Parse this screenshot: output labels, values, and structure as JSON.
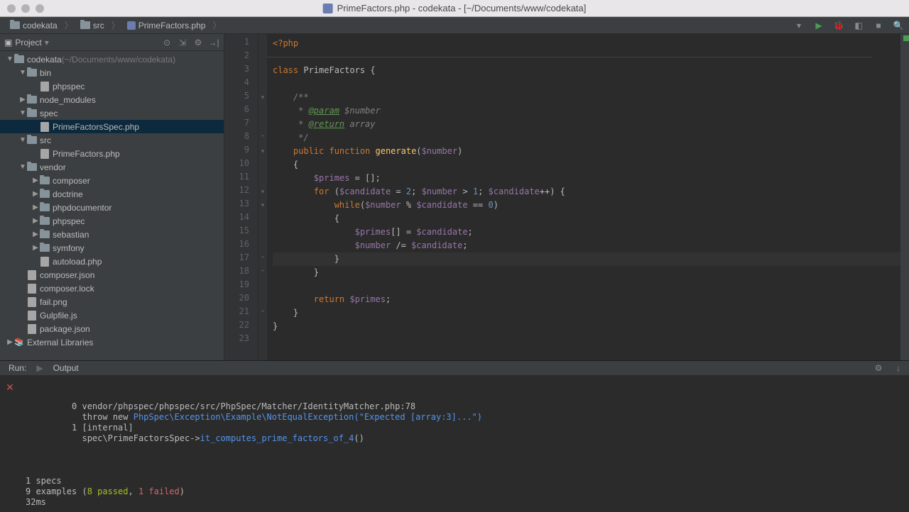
{
  "window": {
    "title": "PrimeFactors.php - codekata - [~/Documents/www/codekata]"
  },
  "breadcrumbs": [
    {
      "label": "codekata",
      "type": "folder"
    },
    {
      "label": "src",
      "type": "folder"
    },
    {
      "label": "PrimeFactors.php",
      "type": "file"
    }
  ],
  "sidebar": {
    "title": "Project",
    "items": [
      {
        "label": "codekata",
        "hint": "(~/Documents/www/codekata)",
        "type": "folder",
        "indent": 0,
        "chevron": "down"
      },
      {
        "label": "bin",
        "type": "folder",
        "indent": 1,
        "chevron": "down"
      },
      {
        "label": "phpspec",
        "type": "file",
        "indent": 2,
        "chevron": ""
      },
      {
        "label": "node_modules",
        "type": "folder",
        "indent": 1,
        "chevron": "right"
      },
      {
        "label": "spec",
        "type": "folder",
        "indent": 1,
        "chevron": "down"
      },
      {
        "label": "PrimeFactorsSpec.php",
        "type": "file",
        "indent": 2,
        "chevron": "",
        "selected": true
      },
      {
        "label": "src",
        "type": "folder",
        "indent": 1,
        "chevron": "down"
      },
      {
        "label": "PrimeFactors.php",
        "type": "file",
        "indent": 2,
        "chevron": ""
      },
      {
        "label": "vendor",
        "type": "folder",
        "indent": 1,
        "chevron": "down"
      },
      {
        "label": "composer",
        "type": "folder",
        "indent": 2,
        "chevron": "right"
      },
      {
        "label": "doctrine",
        "type": "folder",
        "indent": 2,
        "chevron": "right"
      },
      {
        "label": "phpdocumentor",
        "type": "folder",
        "indent": 2,
        "chevron": "right"
      },
      {
        "label": "phpspec",
        "type": "folder",
        "indent": 2,
        "chevron": "right"
      },
      {
        "label": "sebastian",
        "type": "folder",
        "indent": 2,
        "chevron": "right"
      },
      {
        "label": "symfony",
        "type": "folder",
        "indent": 2,
        "chevron": "right"
      },
      {
        "label": "autoload.php",
        "type": "file",
        "indent": 2,
        "chevron": ""
      },
      {
        "label": "composer.json",
        "type": "file",
        "indent": 1,
        "chevron": ""
      },
      {
        "label": "composer.lock",
        "type": "file",
        "indent": 1,
        "chevron": ""
      },
      {
        "label": "fail.png",
        "type": "file",
        "indent": 1,
        "chevron": ""
      },
      {
        "label": "Gulpfile.js",
        "type": "file",
        "indent": 1,
        "chevron": ""
      },
      {
        "label": "package.json",
        "type": "file",
        "indent": 1,
        "chevron": ""
      },
      {
        "label": "External Libraries",
        "type": "lib",
        "indent": 0,
        "chevron": "right"
      }
    ]
  },
  "editor": {
    "lines": [
      {
        "n": 1,
        "tokens": [
          [
            "<?php",
            "k-keyword"
          ]
        ]
      },
      {
        "n": 2,
        "tokens": []
      },
      {
        "n": 3,
        "tokens": [
          [
            "class ",
            "k-keyword"
          ],
          [
            "PrimeFactors {",
            ""
          ]
        ]
      },
      {
        "n": 4,
        "tokens": []
      },
      {
        "n": 5,
        "tokens": [
          [
            "    /**",
            "k-comment"
          ]
        ],
        "fold": "▾"
      },
      {
        "n": 6,
        "tokens": [
          [
            "     * ",
            "k-comment"
          ],
          [
            "@param",
            "k-doctag"
          ],
          [
            " $number",
            "k-comment"
          ]
        ]
      },
      {
        "n": 7,
        "tokens": [
          [
            "     * ",
            "k-comment"
          ],
          [
            "@return",
            "k-doctag"
          ],
          [
            " array",
            "k-comment"
          ]
        ]
      },
      {
        "n": 8,
        "tokens": [
          [
            "     */",
            "k-comment"
          ]
        ],
        "fold": "⌃"
      },
      {
        "n": 9,
        "tokens": [
          [
            "    public function ",
            "k-keyword"
          ],
          [
            "generate",
            "k-func"
          ],
          [
            "(",
            ""
          ],
          [
            "$number",
            "k-var"
          ],
          [
            ")",
            ""
          ]
        ],
        "fold": "▾"
      },
      {
        "n": 10,
        "tokens": [
          [
            "    {",
            ""
          ]
        ]
      },
      {
        "n": 11,
        "tokens": [
          [
            "        ",
            ""
          ],
          [
            "$primes",
            "k-var"
          ],
          [
            " = [];",
            ""
          ]
        ]
      },
      {
        "n": 12,
        "tokens": [
          [
            "        ",
            ""
          ],
          [
            "for ",
            "k-keyword"
          ],
          [
            "(",
            ""
          ],
          [
            "$candidate",
            "k-var"
          ],
          [
            " = ",
            ""
          ],
          [
            "2",
            "k-num"
          ],
          [
            "; ",
            ""
          ],
          [
            "$number",
            "k-var"
          ],
          [
            " > ",
            ""
          ],
          [
            "1",
            "k-num"
          ],
          [
            "; ",
            ""
          ],
          [
            "$candidate",
            "k-var"
          ],
          [
            "++) {",
            ""
          ]
        ],
        "fold": "▾"
      },
      {
        "n": 13,
        "tokens": [
          [
            "            ",
            ""
          ],
          [
            "while",
            "k-keyword"
          ],
          [
            "(",
            ""
          ],
          [
            "$number",
            "k-var"
          ],
          [
            " % ",
            ""
          ],
          [
            "$candidate",
            "k-var"
          ],
          [
            " == ",
            ""
          ],
          [
            "0",
            "k-num"
          ],
          [
            ")",
            ""
          ]
        ],
        "fold": "▾"
      },
      {
        "n": 14,
        "tokens": [
          [
            "            {",
            ""
          ]
        ]
      },
      {
        "n": 15,
        "tokens": [
          [
            "                ",
            ""
          ],
          [
            "$primes",
            "k-var"
          ],
          [
            "[] = ",
            ""
          ],
          [
            "$candidate",
            "k-var"
          ],
          [
            ";",
            ""
          ]
        ]
      },
      {
        "n": 16,
        "tokens": [
          [
            "                ",
            ""
          ],
          [
            "$number",
            "k-var"
          ],
          [
            " /= ",
            ""
          ],
          [
            "$candidate",
            "k-var"
          ],
          [
            ";",
            ""
          ]
        ]
      },
      {
        "n": 17,
        "tokens": [
          [
            "            }",
            ""
          ]
        ],
        "hl": true,
        "fold": "⌃"
      },
      {
        "n": 18,
        "tokens": [
          [
            "        }",
            ""
          ]
        ],
        "fold": "⌃"
      },
      {
        "n": 19,
        "tokens": []
      },
      {
        "n": 20,
        "tokens": [
          [
            "        ",
            ""
          ],
          [
            "return ",
            "k-keyword"
          ],
          [
            "$primes",
            "k-var"
          ],
          [
            ";",
            ""
          ]
        ]
      },
      {
        "n": 21,
        "tokens": [
          [
            "    }",
            ""
          ]
        ],
        "fold": "⌃"
      },
      {
        "n": 22,
        "tokens": [
          [
            "}",
            ""
          ]
        ]
      },
      {
        "n": 23,
        "tokens": []
      }
    ]
  },
  "runPanel": {
    "tabs": {
      "run": "Run:",
      "output": "Output"
    },
    "output": {
      "line1_idx": "0 ",
      "line1_rest": "vendor/phpspec/phpspec/src/PhpSpec/Matcher/IdentityMatcher.php:78",
      "line2_pre": "  throw new ",
      "line2_link": "PhpSpec\\Exception\\Example\\NotEqualException(\"Expected [array:3]...\")",
      "line3_idx": "1 ",
      "line3_rest": "[internal]",
      "line4_pre": "  spec\\PrimeFactorsSpec",
      "line4_arrow": "->",
      "line4_link": "it_computes_prime_factors_of_4",
      "line4_paren": "()",
      "summary1": "1 specs",
      "summary2_pre": "9 examples (",
      "summary2_pass": "8 passed",
      "summary2_mid": ", ",
      "summary2_fail": "1 failed",
      "summary2_post": ")",
      "summary3": "32ms"
    }
  }
}
